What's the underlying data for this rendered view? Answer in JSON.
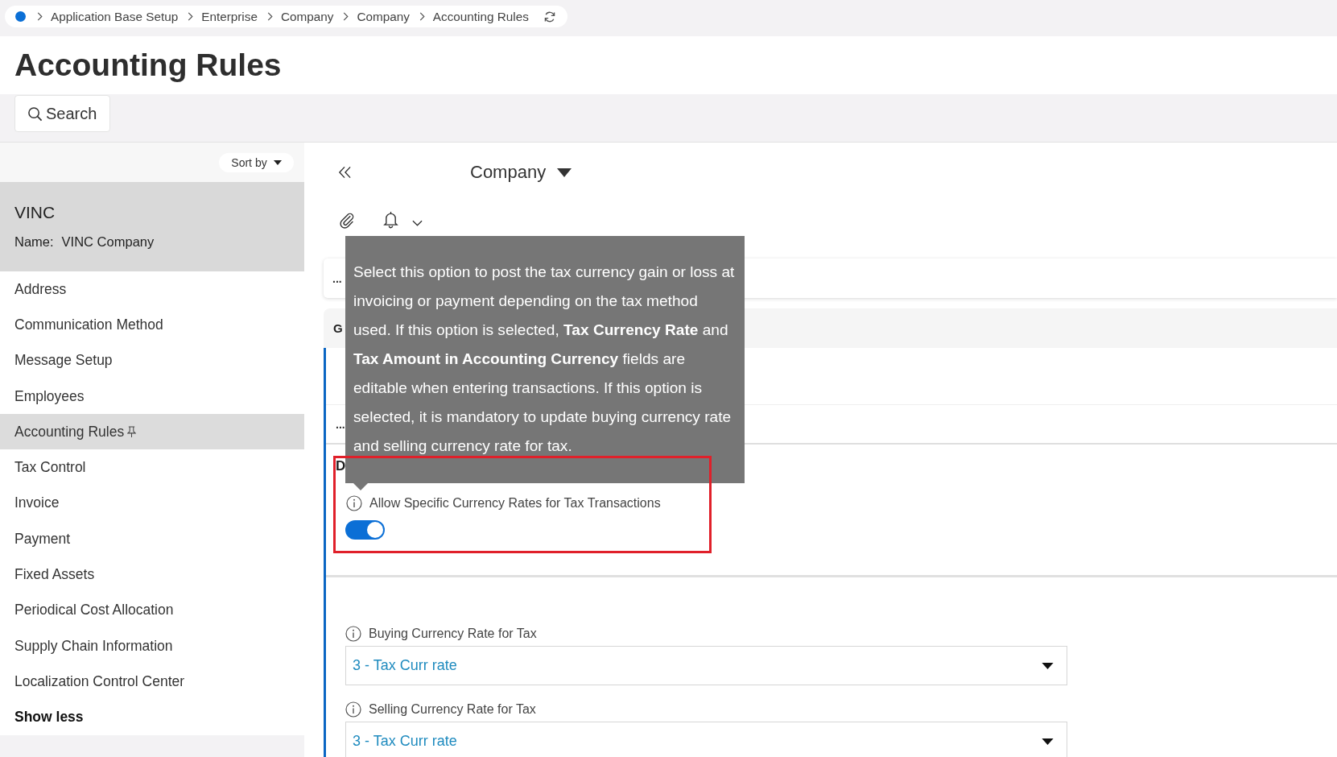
{
  "breadcrumb": {
    "items": [
      "Application Base Setup",
      "Enterprise",
      "Company",
      "Company",
      "Accounting Rules"
    ]
  },
  "page_title": "Accounting Rules",
  "search": {
    "label": "Search"
  },
  "sidebar": {
    "sort_label": "Sort by",
    "record": {
      "title": "VINC",
      "fields": [
        {
          "label": "Name:",
          "value": "VINC Company"
        }
      ]
    },
    "items": [
      {
        "label": "Address",
        "selected": false,
        "pinned": false
      },
      {
        "label": "Communication Method",
        "selected": false,
        "pinned": false
      },
      {
        "label": "Message Setup",
        "selected": false,
        "pinned": false
      },
      {
        "label": "Employees",
        "selected": false,
        "pinned": false
      },
      {
        "label": "Accounting Rules",
        "selected": true,
        "pinned": true
      },
      {
        "label": "Tax Control",
        "selected": false,
        "pinned": false
      },
      {
        "label": "Invoice",
        "selected": false,
        "pinned": false
      },
      {
        "label": "Payment",
        "selected": false,
        "pinned": false
      },
      {
        "label": "Fixed Assets",
        "selected": false,
        "pinned": false
      },
      {
        "label": "Periodical Cost Allocation",
        "selected": false,
        "pinned": false
      },
      {
        "label": "Supply Chain Information",
        "selected": false,
        "pinned": false
      },
      {
        "label": "Localization Control Center",
        "selected": false,
        "pinned": false
      }
    ],
    "show_less": "Show less"
  },
  "detail": {
    "record_selector": "Company",
    "card_menu": "...",
    "tabs": [
      {
        "label": "G",
        "selected": false
      }
    ],
    "row_menu": "...",
    "section": {
      "title": "D",
      "toggle": {
        "label": "Allow Specific Currency Rates for Tax Transactions",
        "on": true,
        "highlighted": true
      },
      "fields": [
        {
          "label": "Buying Currency Rate for Tax",
          "value": "3 - Tax Curr rate"
        },
        {
          "label": "Selling Currency Rate for Tax",
          "value": "3 - Tax Curr rate"
        }
      ]
    }
  },
  "tooltip": {
    "text": "Select this option to post the tax currency gain or loss at invoicing or payment depending on the tax method used. If this option is selected, **Tax Currency Rate** and **Tax Amount in Accounting Currency** fields are editable when entering transactions. If this option is selected, it is mandatory to update buying currency rate and selling currency rate for tax."
  }
}
